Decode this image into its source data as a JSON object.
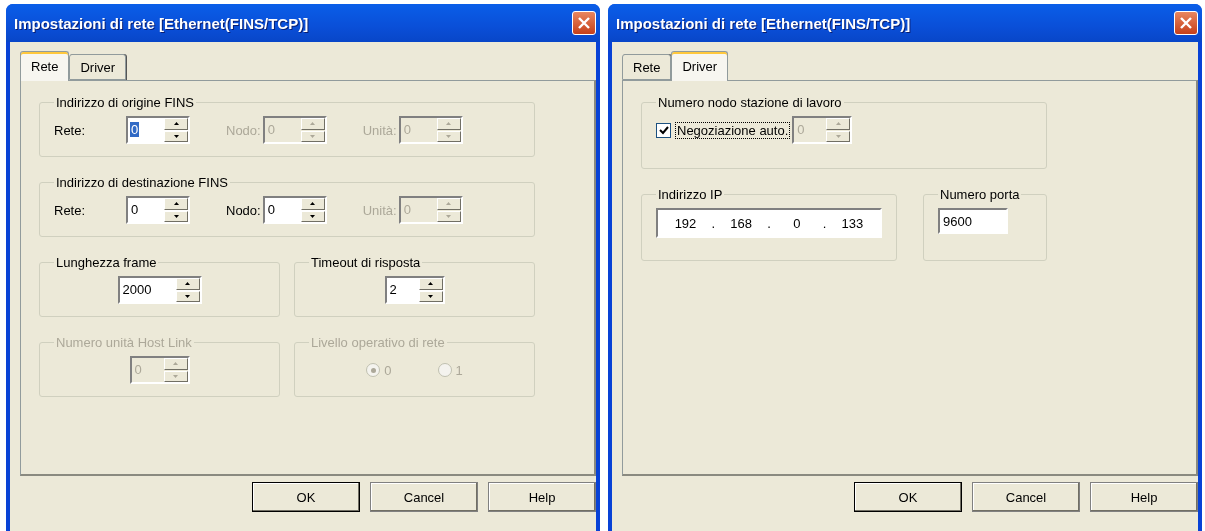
{
  "dialogs": [
    {
      "title": "Impostazioni di rete [Ethernet(FINS/TCP)]",
      "tabs": [
        {
          "label": "Rete",
          "selected": true
        },
        {
          "label": "Driver",
          "selected": false
        }
      ],
      "rows": [
        [
          {
            "kind": "spin_row",
            "label": "Indirizzo di origine FINS",
            "disabled": false,
            "fields": [
              {
                "label": "Rete:",
                "value": "0",
                "disabled": false,
                "highlighted": true
              },
              {
                "label": "Nodo:",
                "value": "0",
                "disabled": true,
                "highlighted": false
              },
              {
                "label": "Unità:",
                "value": "0",
                "disabled": true,
                "highlighted": false
              }
            ]
          }
        ],
        [
          {
            "kind": "spin_row",
            "label": "Indirizzo di destinazione FINS",
            "disabled": false,
            "fields": [
              {
                "label": "Rete:",
                "value": "0",
                "disabled": false,
                "highlighted": false
              },
              {
                "label": "Nodo:",
                "value": "0",
                "disabled": false,
                "highlighted": false
              },
              {
                "label": "Unità:",
                "value": "0",
                "disabled": true,
                "highlighted": false
              }
            ]
          }
        ],
        [
          {
            "kind": "spin",
            "label": "Lunghezza frame",
            "disabled": false,
            "value": "2000"
          },
          {
            "kind": "spin",
            "label": "Timeout di risposta",
            "disabled": false,
            "value": "2"
          }
        ],
        [
          {
            "kind": "spin",
            "label": "Numero unità Host Link",
            "disabled": true,
            "value": "0"
          },
          {
            "kind": "radio",
            "label": "Livello operativo di rete",
            "disabled": true,
            "options": [
              {
                "label": "0",
                "selected": true
              },
              {
                "label": "1",
                "selected": false
              }
            ]
          }
        ]
      ],
      "buttons": [
        {
          "label": "OK",
          "default": true
        },
        {
          "label": "Cancel",
          "default": false
        },
        {
          "label": "Help",
          "default": false
        }
      ]
    },
    {
      "title": "Impostazioni di rete [Ethernet(FINS/TCP)]",
      "tabs": [
        {
          "label": "Rete",
          "selected": false
        },
        {
          "label": "Driver",
          "selected": true
        }
      ],
      "rows": [
        [
          {
            "kind": "checkbox_spin",
            "label": "Numero nodo stazione di lavoro",
            "disabled": false,
            "checkbox": {
              "label": "Negoziazione auto.",
              "checked": true,
              "focused": true
            },
            "value": "0",
            "value_disabled": true
          }
        ],
        [
          {
            "kind": "ip",
            "label": "Indirizzo IP",
            "disabled": false,
            "octets": [
              "192",
              "168",
              "0",
              "133"
            ],
            "separator": "."
          },
          {
            "kind": "text",
            "label": "Numero porta",
            "disabled": false,
            "value": "9600"
          }
        ]
      ],
      "buttons": [
        {
          "label": "OK",
          "default": true
        },
        {
          "label": "Cancel",
          "default": false
        },
        {
          "label": "Help",
          "default": false
        }
      ]
    }
  ]
}
